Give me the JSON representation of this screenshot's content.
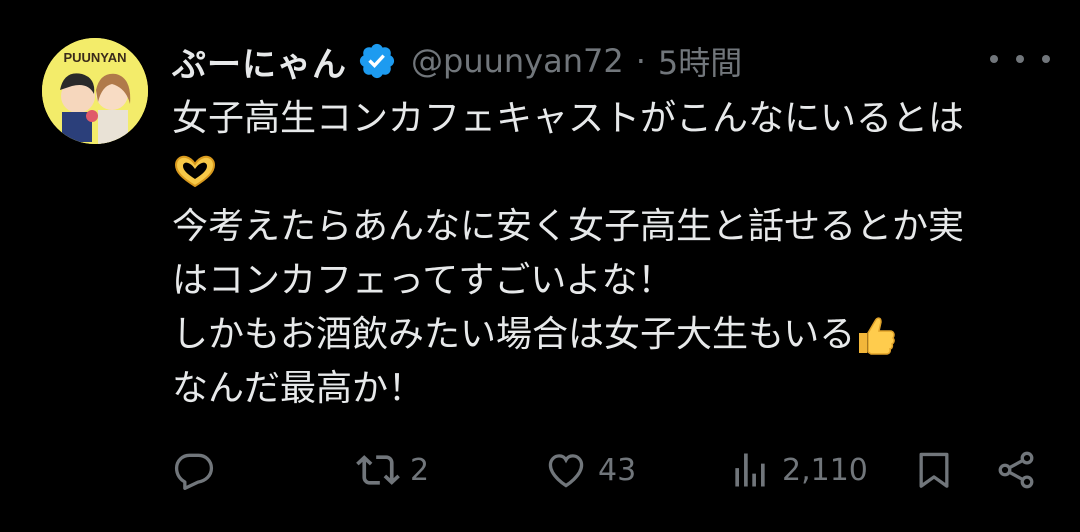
{
  "author": {
    "display_name": "ぷーにゃん",
    "handle": "@puunyan72",
    "separator": "·",
    "time": "5時間",
    "avatar_text": "PUUNYAN"
  },
  "tweet": {
    "lines": [
      "女子高生コンカフェキャストがこんなにいるとは",
      "",
      "今考えたらあんなに安く女子高生と話せるとか実",
      "はコンカフェってすごいよな！",
      "しかもお酒飲みたい場合は女子大生もいる",
      "なんだ最高か！"
    ],
    "emojis": [
      "heart-hands-emoji",
      "thumbs-up-emoji"
    ]
  },
  "actions": {
    "reply": {
      "icon": "reply-icon",
      "count": ""
    },
    "retweet": {
      "icon": "retweet-icon",
      "count": "2"
    },
    "like": {
      "icon": "heart-icon",
      "count": "43"
    },
    "views": {
      "icon": "views-icon",
      "count": "2,110"
    },
    "bookmark": {
      "icon": "bookmark-icon"
    },
    "share": {
      "icon": "share-icon"
    }
  },
  "colors": {
    "background": "#000000",
    "text": "#e7e9ea",
    "muted": "#71767b",
    "verified": "#1d9bf0",
    "avatar_bg": "#f3ec6a"
  }
}
